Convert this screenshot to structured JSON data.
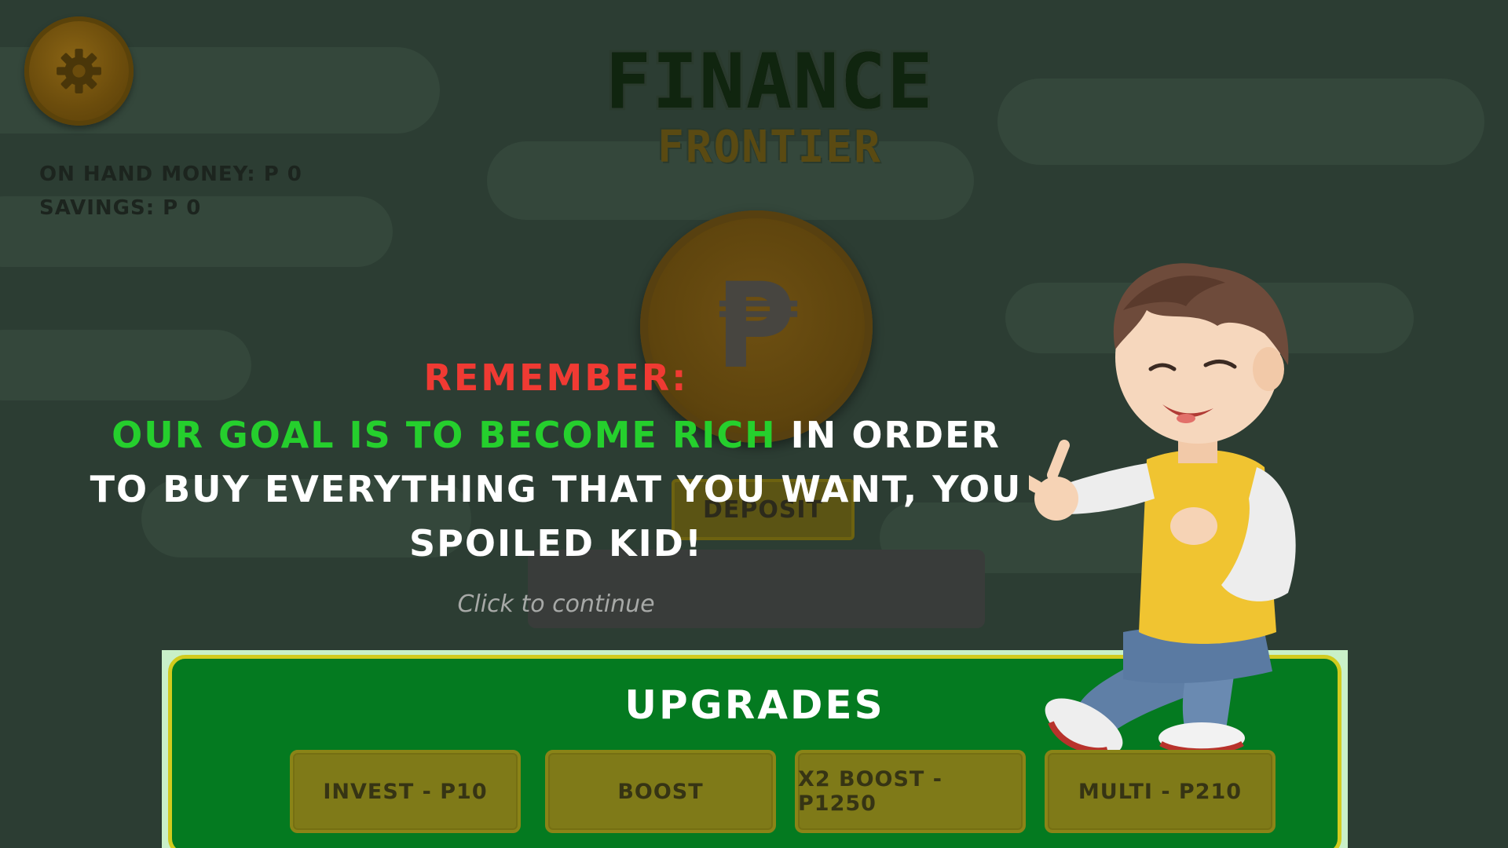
{
  "game": {
    "title_main": "FINANCE",
    "title_sub": "FRONTIER"
  },
  "stats": {
    "on_hand": "ON HAND MONEY: P 0",
    "savings": "SAVINGS: P 0"
  },
  "coin": {
    "symbol": "₱"
  },
  "deposit": {
    "label": "DEPOSIT"
  },
  "dialog": {
    "remember": "REMEMBER:",
    "goal_highlight": "OUR GOAL IS TO BECOME RICH",
    "goal_rest": " IN ORDER TO BUY EVERYTHING THAT YOU WANT, YOU SPOILED KID!",
    "continue_hint": "Click to continue"
  },
  "upgrades": {
    "title": "UPGRADES",
    "buttons": [
      {
        "label": "INVEST - P10"
      },
      {
        "label": "BOOST"
      },
      {
        "label": "X2 BOOST - P1250"
      },
      {
        "label": "MULTI - P210"
      }
    ]
  },
  "colors": {
    "background": "#2c3d33",
    "remember": "#f03a33",
    "goal_highlight": "#25cf2d",
    "upgrades_panel": "#047a20",
    "upgrade_button": "#7f7a18"
  },
  "icons": [
    "gear-icon",
    "peso-icon"
  ]
}
